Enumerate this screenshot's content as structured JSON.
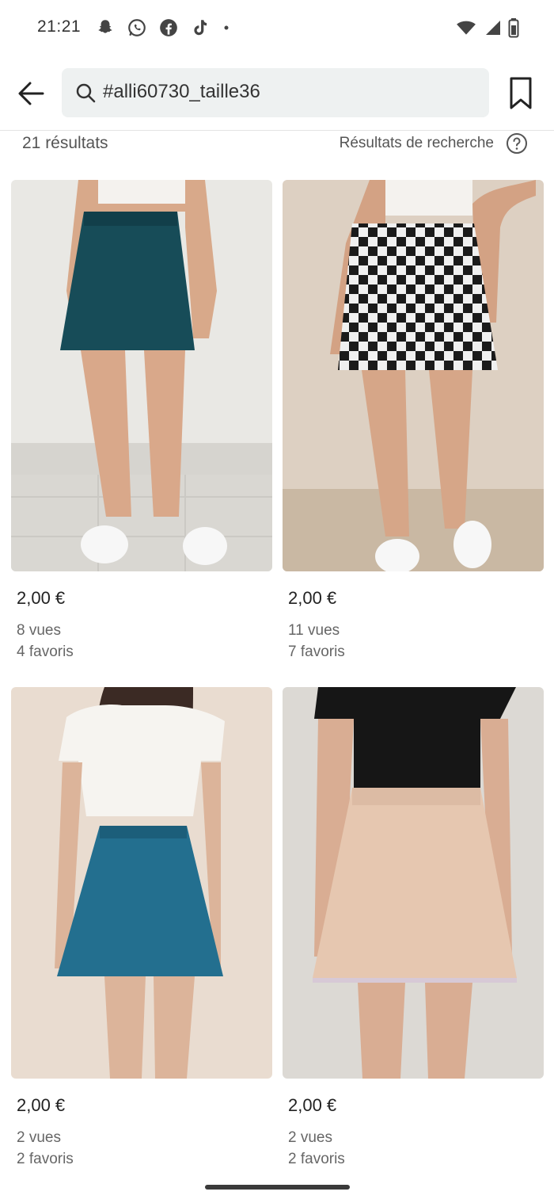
{
  "status_bar": {
    "time": "21:21",
    "app_icons": [
      "snapchat-icon",
      "whatsapp-icon",
      "facebook-icon",
      "tiktok-icon",
      "dot-icon"
    ],
    "indicators": [
      "wifi-icon",
      "signal-icon",
      "battery-icon"
    ]
  },
  "header": {
    "search_query": "#alli60730_taille36",
    "back_icon": "arrow-left-icon",
    "save_icon": "bookmark-icon"
  },
  "results": {
    "count_label": "21 résultats",
    "label": "Résultats de recherche",
    "help_icon": "question-circle-icon"
  },
  "items": [
    {
      "price": "2,00 €",
      "views": "8 vues",
      "favorites": "4 favoris",
      "image": "teal skirt, white crop top, white sneakers"
    },
    {
      "price": "2,00 €",
      "views": "11 vues",
      "favorites": "7 favoris",
      "image": "black and white checkered skirt"
    },
    {
      "price": "2,00 €",
      "views": "2 vues",
      "favorites": "2 favoris",
      "image": "blue skirt, white t-shirt"
    },
    {
      "price": "2,00 €",
      "views": "2 vues",
      "favorites": "2 favoris",
      "image": "beige skirt, black t-shirt"
    }
  ],
  "colors": {
    "search_bg": "#eef1f1",
    "text": "#1a1a1a",
    "muted": "#666666"
  }
}
